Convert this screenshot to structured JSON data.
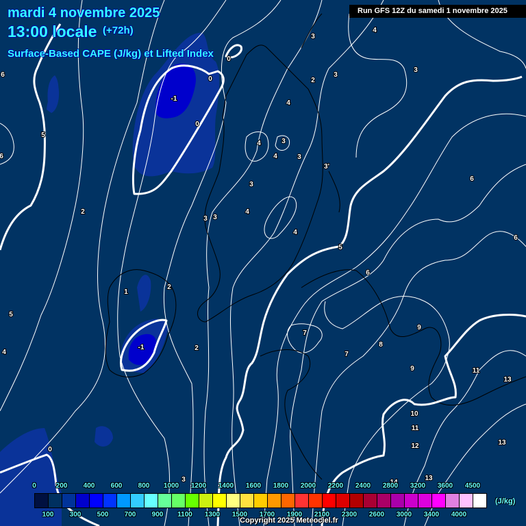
{
  "header": {
    "date": "mardi 4 novembre 2025",
    "time": "13:00 locale",
    "lead": "(+72h)",
    "subtitle": "Surface-Based CAPE (J/kg) et Lifted Index",
    "run": "Run GFS 12Z du samedi 1 novembre 2025"
  },
  "colorbar": {
    "unit": "(J/kg)",
    "colors": [
      "#001040",
      "#003060",
      "#003399",
      "#0000cc",
      "#0000ff",
      "#0033ff",
      "#0099ff",
      "#33ccff",
      "#66ffff",
      "#66ff99",
      "#66ff66",
      "#66ff00",
      "#ccf010",
      "#ffff00",
      "#ffff80",
      "#ffe040",
      "#ffcc00",
      "#ff9900",
      "#ff6600",
      "#ff3333",
      "#ff3300",
      "#ff0000",
      "#dd0000",
      "#b30000",
      "#aa0033",
      "#aa0066",
      "#aa00aa",
      "#cc00cc",
      "#dd00dd",
      "#ff00ff",
      "#e080e0",
      "#ffc0ff",
      "#ffffff"
    ],
    "top_labels": [
      "0",
      "200",
      "400",
      "600",
      "800",
      "1000",
      "1200",
      "1400",
      "1600",
      "1800",
      "2000",
      "2200",
      "2400",
      "2800",
      "3200",
      "3600",
      "4500"
    ],
    "bottom_labels": [
      "100",
      "300",
      "500",
      "700",
      "900",
      "1100",
      "1300",
      "1500",
      "1700",
      "1900",
      "2100",
      "2300",
      "2600",
      "3000",
      "3400",
      "4000"
    ]
  },
  "lifted_index_labels": [
    "3",
    "4",
    "3",
    "3",
    "2",
    "0",
    "0",
    "-1",
    "0",
    "4",
    "3",
    "4",
    "4",
    "3",
    "3'",
    "3",
    "6",
    "5",
    "6",
    "6",
    "2",
    "3",
    "3",
    "4",
    "4",
    "6",
    "5",
    "6",
    "1",
    "2",
    "5",
    "9",
    "7",
    "8",
    "-1",
    "2",
    "7",
    "9",
    "11",
    "4",
    "13",
    "10",
    "11",
    "12",
    "13",
    "0",
    "13",
    "14",
    "3"
  ],
  "copyright": "Copyright 2025 Meteociel.fr",
  "colors": {
    "background": "#013363",
    "title": "#33ffff",
    "cape_200": "#0a3399",
    "cape_300": "#0000cc"
  }
}
